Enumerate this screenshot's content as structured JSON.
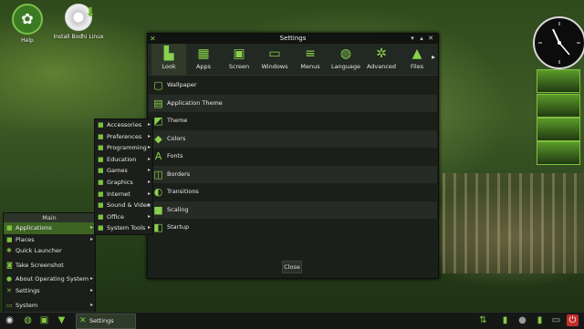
{
  "desktop": {
    "icons": [
      {
        "label": "Help",
        "icon": "help-globe-icon"
      },
      {
        "label": "Install Bodhi Linux",
        "icon": "install-disc-icon"
      }
    ]
  },
  "settings": {
    "title": "Settings",
    "toolbar": [
      {
        "label": "Look",
        "icon": "look-icon"
      },
      {
        "label": "Apps",
        "icon": "apps-icon"
      },
      {
        "label": "Screen",
        "icon": "screen-icon"
      },
      {
        "label": "Windows",
        "icon": "windows-icon"
      },
      {
        "label": "Menus",
        "icon": "menus-icon"
      },
      {
        "label": "Language",
        "icon": "language-globe-icon"
      },
      {
        "label": "Advanced",
        "icon": "advanced-gears-icon"
      },
      {
        "label": "Files",
        "icon": "files-icon"
      }
    ],
    "items": [
      {
        "label": "Wallpaper",
        "icon": "wallpaper-icon"
      },
      {
        "label": "Application Theme",
        "icon": "theme-icon"
      },
      {
        "label": "Theme",
        "icon": "theme-frame-icon"
      },
      {
        "label": "Colors",
        "icon": "colors-icon"
      },
      {
        "label": "Fonts",
        "icon": "fonts-icon"
      },
      {
        "label": "Borders",
        "icon": "borders-icon"
      },
      {
        "label": "Transitions",
        "icon": "transitions-icon"
      },
      {
        "label": "Scaling",
        "icon": "scaling-icon"
      },
      {
        "label": "Startup",
        "icon": "startup-icon"
      }
    ],
    "close_label": "Close"
  },
  "main_menu": {
    "header": "Main",
    "items": [
      {
        "label": "Applications",
        "submenu": true
      },
      {
        "label": "Places",
        "submenu": true
      },
      {
        "label": "Quick Launcher",
        "submenu": false
      },
      {
        "label": "Take Screenshot",
        "submenu": false
      },
      {
        "label": "About Operating System",
        "submenu": true
      },
      {
        "label": "Settings",
        "submenu": true
      },
      {
        "label": "System",
        "submenu": true
      }
    ]
  },
  "apps_menu": {
    "items": [
      "Accessories",
      "Preferences",
      "Programming",
      "Education",
      "Games",
      "Graphics",
      "Internet",
      "Sound & Video",
      "Office",
      "System Tools"
    ]
  },
  "taskbar": {
    "window_label": "Settings"
  },
  "colors": {
    "accent": "#7ad13b",
    "window_bg": "#1b1f1a",
    "selected": "#3e6424"
  }
}
